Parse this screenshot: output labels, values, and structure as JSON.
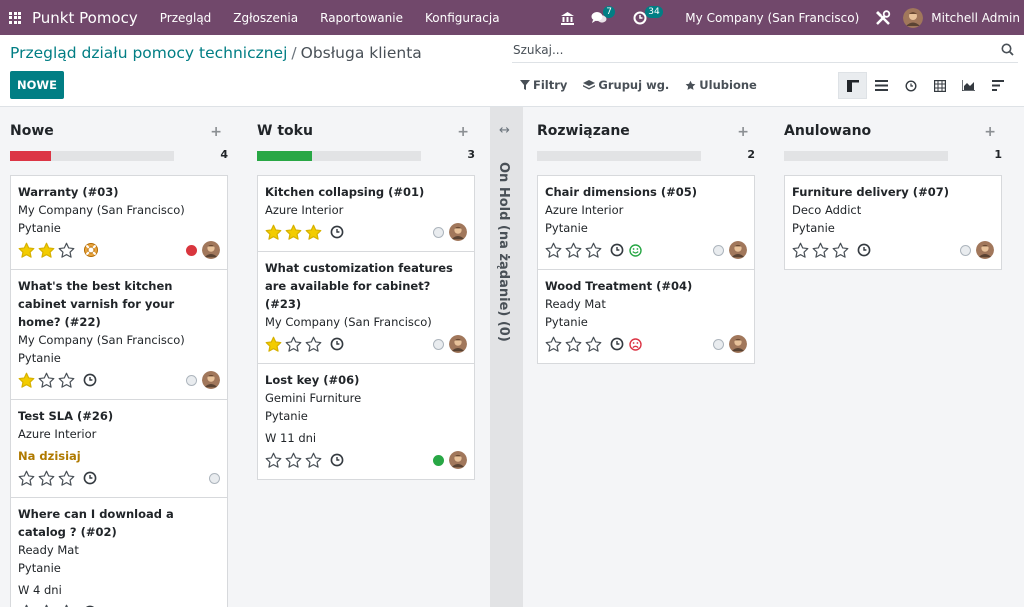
{
  "navbar": {
    "app_name": "Punkt Pomocy",
    "menu": [
      "Przegląd",
      "Zgłoszenia",
      "Raportowanie",
      "Konfiguracja"
    ],
    "messages_count": "7",
    "activities_count": "34",
    "company": "My Company (San Francisco)",
    "user": "Mitchell Admin"
  },
  "breadcrumb": {
    "parent": "Przegląd działu pomocy technicznej",
    "separator": "/",
    "current": "Obsługa klienta"
  },
  "toolbar": {
    "new_label": "NOWE",
    "search_placeholder": "Szukaj...",
    "filters_label": "Filtry",
    "group_by_label": "Grupuj wg.",
    "favorites_label": "Ulubione"
  },
  "colors": {
    "brand": "#71486b",
    "accent": "#017e84",
    "progress_red": "#dc3545",
    "progress_green": "#28a745",
    "star_filled": "#f3cc00"
  },
  "columns": [
    {
      "title": "Nowe",
      "count": "4",
      "progress": {
        "color": "#dc3545",
        "fraction": 0.25
      },
      "cards": [
        {
          "title": "Warranty (#03)",
          "lines": [
            "My Company (San Francisco)",
            "Pytanie"
          ],
          "extra": "",
          "deadline": "",
          "stars": 2,
          "icon": "lifebuoy-icon",
          "status": "red"
        },
        {
          "title": "What's the best kitchen cabinet varnish for your home? (#22)",
          "lines": [
            "My Company (San Francisco)",
            "Pytanie"
          ],
          "extra": "",
          "deadline": "",
          "stars": 1,
          "icon": "clock-icon",
          "status": "grey"
        },
        {
          "title": "Test SLA (#26)",
          "lines": [
            "Azure Interior"
          ],
          "extra": "",
          "deadline": "Na dzisiaj",
          "stars": 0,
          "icon": "clock-icon",
          "status": "grey",
          "no_avatar": true
        },
        {
          "title": "Where can I download a catalog ? (#02)",
          "lines": [
            "Ready Mat",
            "Pytanie"
          ],
          "extra": "W 4 dni",
          "deadline": "",
          "stars": 0,
          "icon": "clock-icon",
          "status": "grey",
          "no_avatar": true
        }
      ]
    },
    {
      "title": "W toku",
      "count": "3",
      "progress": {
        "color": "#28a745",
        "fraction": 0.333
      },
      "cards": [
        {
          "title": "Kitchen collapsing (#01)",
          "lines": [
            "Azure Interior"
          ],
          "extra": "",
          "deadline": "",
          "stars": 3,
          "icon": "clock-icon",
          "status": "grey"
        },
        {
          "title": "What customization features are available for cabinet? (#23)",
          "lines": [
            "My Company (San Francisco)"
          ],
          "extra": "",
          "deadline": "",
          "stars": 1,
          "icon": "clock-icon",
          "status": "grey"
        },
        {
          "title": "Lost key (#06)",
          "lines": [
            "Gemini Furniture",
            "Pytanie"
          ],
          "extra": "W 11 dni",
          "deadline": "",
          "stars": 0,
          "icon": "clock-icon",
          "status": "green"
        }
      ]
    },
    {
      "title": "Rozwiązane",
      "count": "2",
      "progress": {
        "color": "#28a745",
        "fraction": 0
      },
      "cards": [
        {
          "title": "Chair dimensions (#05)",
          "lines": [
            "Azure Interior",
            "Pytanie"
          ],
          "extra": "",
          "deadline": "",
          "stars": 0,
          "icon": "clock-icon",
          "rating": "smile-icon",
          "status": "grey"
        },
        {
          "title": "Wood Treatment (#04)",
          "lines": [
            "Ready Mat",
            "Pytanie"
          ],
          "extra": "",
          "deadline": "",
          "stars": 0,
          "icon": "clock-icon",
          "rating": "frown-icon",
          "status": "grey"
        }
      ]
    },
    {
      "title": "Anulowano",
      "count": "1",
      "progress": {
        "color": "#28a745",
        "fraction": 0
      },
      "cards": [
        {
          "title": "Furniture delivery (#07)",
          "lines": [
            "Deco Addict",
            "Pytanie"
          ],
          "extra": "",
          "deadline": "",
          "stars": 0,
          "icon": "clock-icon",
          "status": "grey"
        }
      ]
    }
  ],
  "folded_column": {
    "label": "On Hold (na żądanie) (0)"
  }
}
